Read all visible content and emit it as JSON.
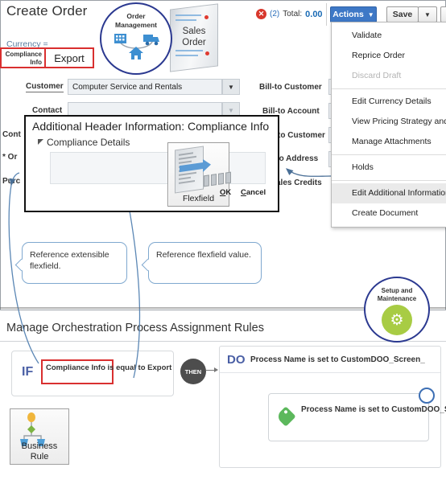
{
  "header": {
    "page_title": "Create Order",
    "currency_label": "Currency =",
    "error_icon": "error-circle-icon",
    "error_count": "(2)",
    "total_label": "Total:",
    "total_value": "0.00",
    "actions_button": "Actions",
    "actions_caret": "▼",
    "save_button": "Save",
    "save_split_caret": "▼",
    "submit_button": "S"
  },
  "actions_menu": {
    "items": [
      {
        "label": "Validate",
        "disabled": false,
        "highlight": false
      },
      {
        "label": "Reprice Order",
        "disabled": false,
        "highlight": false
      },
      {
        "label": "Discard Draft",
        "disabled": true,
        "highlight": false
      },
      {
        "label": "Edit Currency Details",
        "disabled": false,
        "highlight": false
      },
      {
        "label": "View Pricing Strategy and S",
        "disabled": false,
        "highlight": false
      },
      {
        "label": "Manage Attachments",
        "disabled": false,
        "highlight": false
      },
      {
        "label": "Holds",
        "disabled": false,
        "highlight": false
      },
      {
        "label": "Edit Additional Information",
        "disabled": false,
        "highlight": true
      },
      {
        "label": "Create Document",
        "disabled": false,
        "highlight": false
      }
    ]
  },
  "badges": {
    "order_management": {
      "line1": "Order",
      "line2": "Management"
    },
    "sales_order": {
      "line1": "Sales",
      "line2": "Order"
    },
    "setup_maintenance": {
      "line1": "Setup and",
      "line2": "Maintenance",
      "icon": "gears-icon"
    }
  },
  "form": {
    "left_fields": [
      {
        "label": "Customer",
        "value": "Computer Service and Rentals",
        "caret": "▼",
        "dim": false
      },
      {
        "label": "Contact",
        "value": "",
        "caret": "▼",
        "dim": true
      },
      {
        "label": "Cont",
        "value": "",
        "caret": "",
        "dim": true
      },
      {
        "label": "* Or",
        "value": "",
        "caret": "",
        "dim": true
      },
      {
        "label": "Purc",
        "value": "",
        "caret": "",
        "dim": true
      }
    ],
    "right_fields": [
      {
        "label": "Bill-to Customer"
      },
      {
        "label": "Bill-to Account"
      },
      {
        "label": "to Customer"
      },
      {
        "label": "-to Address"
      },
      {
        "label": "ales Credits"
      }
    ]
  },
  "flexfield_dialog": {
    "title": "Additional Header Information: Compliance Info",
    "section_label": "Compliance Details",
    "field_label": "Compliance Info",
    "field_value": "Export",
    "graphic_caption": "Flexfield",
    "ok_button": "OK",
    "cancel_button": "Cancel"
  },
  "callouts": {
    "extensible": "Reference extensible flexfield.",
    "value": "Reference  flexfield value."
  },
  "rules": {
    "title": "Manage Orchestration Process Assignment Rules",
    "if_keyword": "IF",
    "if_condition": "Compliance Info is equal to Export",
    "then_keyword": "THEN",
    "do_keyword": "DO",
    "do_statement": "Process Name is set to CustomDOO_Screen_",
    "do_action": "Process Name is set to CustomDOO_Screen_Export...",
    "business_rule_icon": {
      "line1": "Business",
      "line2": "Rule"
    }
  },
  "colors": {
    "accent_blue": "#3e78c6",
    "badge_ring": "#2b3990",
    "error_red": "#d8372c",
    "highlight_red": "#d92f2f",
    "green_gear": "#a8cc44",
    "tag_green": "#5cb85c",
    "rule_keyword": "#4a5fa5"
  }
}
